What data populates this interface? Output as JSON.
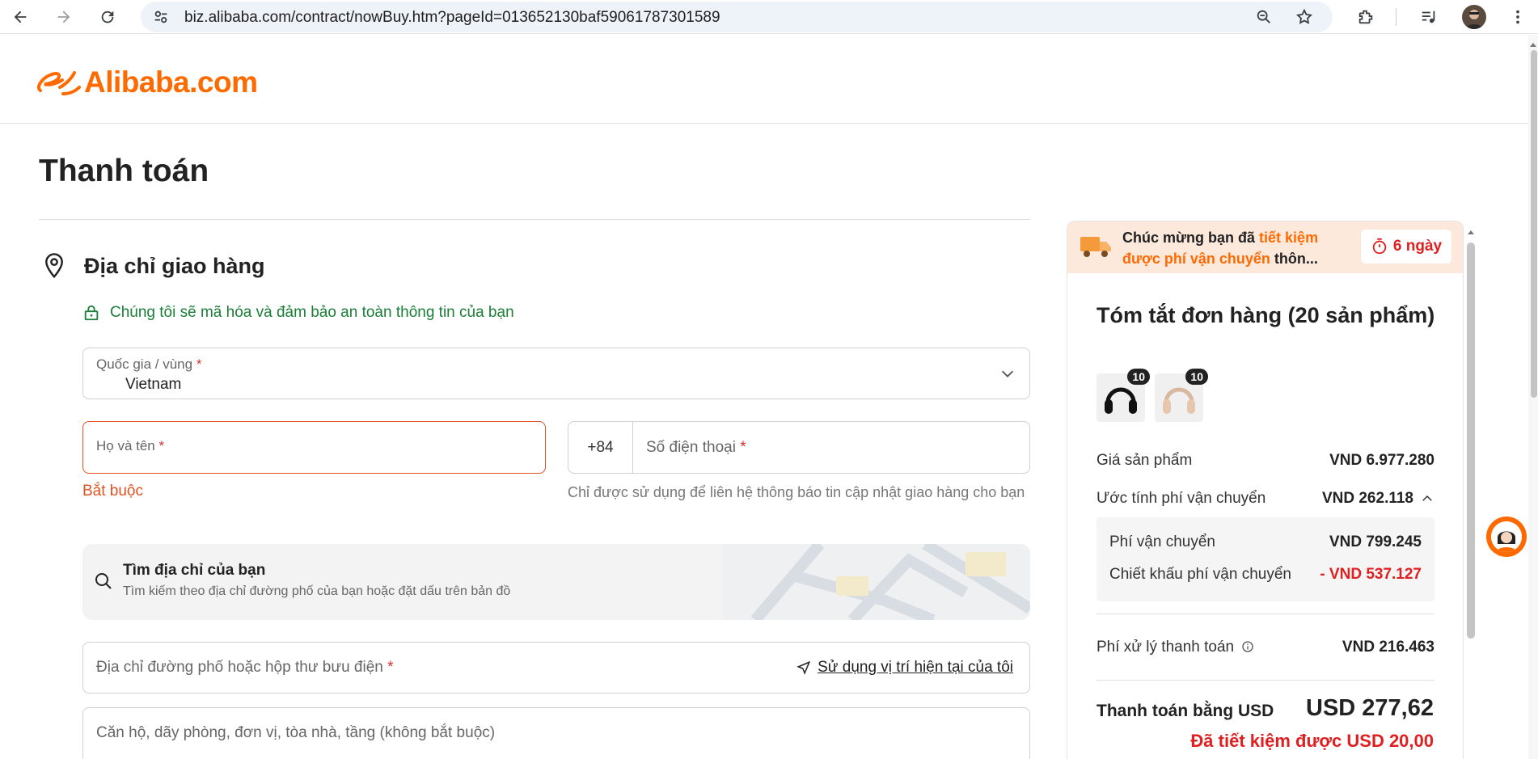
{
  "browser": {
    "url": "biz.alibaba.com/contract/nowBuy.htm?pageId=013652130baf59061787301589"
  },
  "header": {
    "logo_text": "Alibaba.com"
  },
  "page": {
    "title": "Thanh toán"
  },
  "shipping": {
    "section_title": "Địa chỉ giao hàng",
    "secure_note": "Chúng tôi sẽ mã hóa và đảm bảo an toàn thông tin của bạn",
    "country_label": "Quốc gia / vùng",
    "country_value": "Vietnam",
    "name_label": "Họ và tên",
    "name_error": "Bắt buộc",
    "phone_code": "+84",
    "phone_label": "Số điện thoại",
    "phone_help": "Chỉ được sử dụng để liên hệ thông báo tin cập nhật giao hàng cho bạn",
    "search_title": "Tìm địa chỉ của bạn",
    "search_sub": "Tìm kiếm theo địa chỉ đường phố của bạn hoặc đặt dấu trên bản đồ",
    "street_label": "Địa chỉ đường phố hoặc hộp thư bưu điện",
    "use_location": "Sử dụng vị trí hiện tại của tôi",
    "apt_label": "Căn hộ, dãy phòng, đơn vị, tòa nhà, tầng (không bắt buộc)",
    "required_mark": "*"
  },
  "summary": {
    "promo_prefix": "Chúc mừng bạn đã ",
    "promo_highlight": "tiết kiệm được phí vận chuyển",
    "promo_suffix": " thôn...",
    "promo_timer": "6 ngày",
    "title": "Tóm tắt đơn hàng (20 sản phẩm)",
    "items": [
      {
        "qty": "10"
      },
      {
        "qty": "10"
      }
    ],
    "product_price_label": "Giá sản phẩm",
    "product_price": "VND 6.977.280",
    "ship_est_label": "Ước tính phí vận chuyển",
    "ship_est": "VND 262.118",
    "ship_fee_label": "Phí vận chuyển",
    "ship_fee": "VND 799.245",
    "ship_discount_label": "Chiết khấu phí vận chuyển",
    "ship_discount": "- VND 537.127",
    "processing_label": "Phí xử lý thanh toán",
    "processing_fee": "VND 216.463",
    "total_label": "Thanh toán bằng USD",
    "total": "USD 277,62",
    "saved": "Đã tiết kiệm được USD 20,00"
  },
  "colors": {
    "brand": "#ff6a00",
    "error": "#e05320",
    "secure": "#1a7f37",
    "discount": "#e02020"
  }
}
